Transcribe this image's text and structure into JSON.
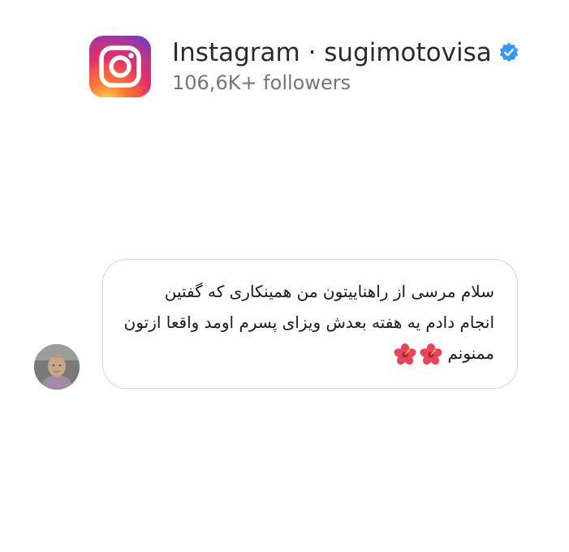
{
  "header": {
    "title": "Instagram · sugimotovisa",
    "followers": "106,6K+ followers",
    "logo_icon": "instagram-logo-icon",
    "verified_icon": "verified-badge-icon"
  },
  "message": {
    "text": "سلام مرسی از راهناییتون  من همینکاری که گفتین\nانجام دادم یه هفته بعدش ویزای پسرم اومد واقعا ازتون\nممنونم",
    "emojis": [
      "hibiscus-icon",
      "hibiscus-icon"
    ]
  },
  "colors": {
    "verified": "#3897f0",
    "bubble_border": "#d4d4d4",
    "followers_text": "#757575"
  }
}
